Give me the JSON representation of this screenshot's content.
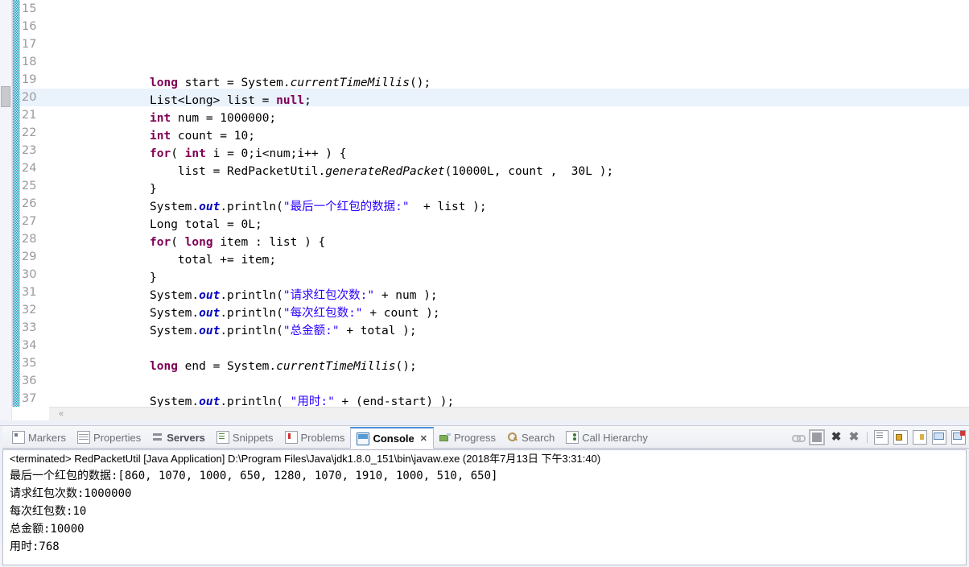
{
  "editor": {
    "first_line": 15,
    "last_line": 37,
    "highlighted_line": 20,
    "lines": [
      {
        "n": 15,
        "tokens": []
      },
      {
        "n": 16,
        "tokens": []
      },
      {
        "n": 17,
        "tokens": [
          {
            "t": "long",
            "c": "kw"
          },
          {
            "t": " start = System.",
            "c": "pln"
          },
          {
            "t": "currentTimeMillis",
            "c": "mth"
          },
          {
            "t": "();",
            "c": "pln"
          }
        ]
      },
      {
        "n": 18,
        "tokens": [
          {
            "t": "List<Long> list = ",
            "c": "pln"
          },
          {
            "t": "null",
            "c": "kw"
          },
          {
            "t": ";",
            "c": "pln"
          }
        ]
      },
      {
        "n": 19,
        "tokens": [
          {
            "t": "int",
            "c": "kw"
          },
          {
            "t": " num = 1000000;",
            "c": "pln"
          }
        ]
      },
      {
        "n": 20,
        "tokens": [
          {
            "t": "int",
            "c": "kw"
          },
          {
            "t": " count = 10;",
            "c": "pln"
          }
        ]
      },
      {
        "n": 21,
        "tokens": [
          {
            "t": "for",
            "c": "kw"
          },
          {
            "t": "( ",
            "c": "pln"
          },
          {
            "t": "int",
            "c": "kw"
          },
          {
            "t": " i = 0;i<num;i++ ) {",
            "c": "pln"
          }
        ]
      },
      {
        "n": 22,
        "tokens": [
          {
            "t": "    list = RedPacketUtil.",
            "c": "pln"
          },
          {
            "t": "generateRedPacket",
            "c": "mth"
          },
          {
            "t": "(10000L, count ,  30L );",
            "c": "pln"
          }
        ]
      },
      {
        "n": 23,
        "tokens": [
          {
            "t": "}",
            "c": "pln"
          }
        ]
      },
      {
        "n": 24,
        "tokens": [
          {
            "t": "System.",
            "c": "pln"
          },
          {
            "t": "out",
            "c": "stat"
          },
          {
            "t": ".println(",
            "c": "pln"
          },
          {
            "t": "\"最后一个红包的数据:\"",
            "c": "str"
          },
          {
            "t": "  + list );",
            "c": "pln"
          }
        ]
      },
      {
        "n": 25,
        "tokens": [
          {
            "t": "Long total = 0L;",
            "c": "pln"
          }
        ]
      },
      {
        "n": 26,
        "tokens": [
          {
            "t": "for",
            "c": "kw"
          },
          {
            "t": "( ",
            "c": "pln"
          },
          {
            "t": "long",
            "c": "kw"
          },
          {
            "t": " item : list ) {",
            "c": "pln"
          }
        ]
      },
      {
        "n": 27,
        "tokens": [
          {
            "t": "    total += item;",
            "c": "pln"
          }
        ]
      },
      {
        "n": 28,
        "tokens": [
          {
            "t": "}",
            "c": "pln"
          }
        ]
      },
      {
        "n": 29,
        "tokens": [
          {
            "t": "System.",
            "c": "pln"
          },
          {
            "t": "out",
            "c": "stat"
          },
          {
            "t": ".println(",
            "c": "pln"
          },
          {
            "t": "\"请求红包次数:\"",
            "c": "str"
          },
          {
            "t": " + num );",
            "c": "pln"
          }
        ]
      },
      {
        "n": 30,
        "tokens": [
          {
            "t": "System.",
            "c": "pln"
          },
          {
            "t": "out",
            "c": "stat"
          },
          {
            "t": ".println(",
            "c": "pln"
          },
          {
            "t": "\"每次红包数:\"",
            "c": "str"
          },
          {
            "t": " + count );",
            "c": "pln"
          }
        ]
      },
      {
        "n": 31,
        "tokens": [
          {
            "t": "System.",
            "c": "pln"
          },
          {
            "t": "out",
            "c": "stat"
          },
          {
            "t": ".println(",
            "c": "pln"
          },
          {
            "t": "\"总金额:\"",
            "c": "str"
          },
          {
            "t": " + total );",
            "c": "pln"
          }
        ]
      },
      {
        "n": 32,
        "tokens": []
      },
      {
        "n": 33,
        "tokens": [
          {
            "t": "long",
            "c": "kw"
          },
          {
            "t": " end = System.",
            "c": "pln"
          },
          {
            "t": "currentTimeMillis",
            "c": "mth"
          },
          {
            "t": "();",
            "c": "pln"
          }
        ]
      },
      {
        "n": 34,
        "tokens": []
      },
      {
        "n": 35,
        "tokens": [
          {
            "t": "System.",
            "c": "pln"
          },
          {
            "t": "out",
            "c": "stat"
          },
          {
            "t": ".println( ",
            "c": "pln"
          },
          {
            "t": "\"用时:\"",
            "c": "str"
          },
          {
            "t": " + (end-start) );",
            "c": "pln"
          }
        ]
      },
      {
        "n": 36,
        "tokens": []
      },
      {
        "n": 37,
        "tokens": [
          {
            "t": "}",
            "c": "pln",
            "dedent": true
          }
        ]
      }
    ],
    "hscroll_arrow": "«"
  },
  "bottom_view": {
    "tabs": [
      {
        "label": "Markers",
        "icon": "markers-icon",
        "active": false,
        "bold": false
      },
      {
        "label": "Properties",
        "icon": "properties-icon",
        "active": false,
        "bold": false
      },
      {
        "label": "Servers",
        "icon": "servers-icon",
        "active": false,
        "bold": true
      },
      {
        "label": "Snippets",
        "icon": "snippets-icon",
        "active": false,
        "bold": false
      },
      {
        "label": "Problems",
        "icon": "problems-icon",
        "active": false,
        "bold": false
      },
      {
        "label": "Console",
        "icon": "console-icon",
        "active": true,
        "bold": true,
        "close": "✕"
      },
      {
        "label": "Progress",
        "icon": "progress-icon",
        "active": false,
        "bold": false
      },
      {
        "label": "Search",
        "icon": "search-icon",
        "active": false,
        "bold": false
      },
      {
        "label": "Call Hierarchy",
        "icon": "call-hierarchy-icon",
        "active": false,
        "bold": false
      }
    ],
    "toolbar_icons": [
      "link-with-debug-view-icon",
      "terminate-icon",
      "remove-launch-icon",
      "remove-all-terminated-icon",
      "separator",
      "clear-console-icon",
      "scroll-lock-icon",
      "pin-console-icon",
      "display-selected-console-icon",
      "open-console-icon"
    ],
    "console": {
      "header": "<terminated> RedPacketUtil [Java Application] D:\\Program Files\\Java\\jdk1.8.0_151\\bin\\javaw.exe (2018年7月13日 下午3:31:40)",
      "output_lines": [
        "最后一个红包的数据:[860, 1070, 1000, 650, 1280, 1070, 1910, 1000, 510, 650]",
        "请求红包次数:1000000",
        "每次红包数:10",
        "总金额:10000",
        "用时:768"
      ]
    }
  },
  "colors": {
    "keyword": "#7f0055",
    "string": "#2a00ff",
    "static_field": "#0000c0",
    "highlight_line": "#eaf2fc",
    "fold_column": "#1595b8",
    "active_tab_border": "#4a90d9"
  }
}
